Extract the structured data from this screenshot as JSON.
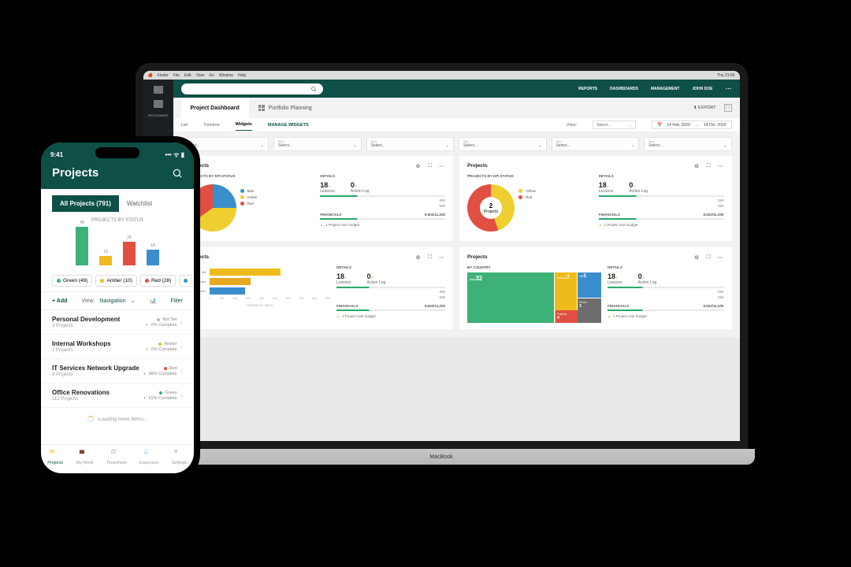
{
  "mac_menubar": {
    "items": [
      "Finder",
      "File",
      "Edit",
      "View",
      "Go",
      "Window",
      "Help"
    ],
    "time": "Thu 21:56"
  },
  "app_header": {
    "links": [
      "REPORTS",
      "DASHBOARDS",
      "MANAGEMENT",
      "JOHN DOE"
    ],
    "search_placeholder": ""
  },
  "tabs": {
    "active": "Project Dashboard",
    "second": "Portfolio Planning",
    "export": "EXPORT"
  },
  "sub_bar": {
    "items": [
      "List",
      "Timeline",
      "Widgets"
    ],
    "manage": "MANAGE WIDGETS",
    "view_label": "View:",
    "select": "Select...",
    "date_from": "14 Feb. 2020",
    "date_to": "14 Oct. 2020"
  },
  "filters": [
    {
      "label": "filter",
      "value": "Select..."
    },
    {
      "label": "filter",
      "value": "Select..."
    },
    {
      "label": "filter",
      "value": "Select..."
    },
    {
      "label": "filter",
      "value": "Select..."
    },
    {
      "label": "filter",
      "value": "Select..."
    },
    {
      "label": "filter",
      "value": "Select..."
    }
  ],
  "widgets": [
    {
      "title": "Projects",
      "chart_title": "PROJECTS BY KPI STATUS",
      "type": "pie",
      "details_title": "DETAILS",
      "m1": {
        "n": "18",
        "plus": "+",
        "label": "Lessons"
      },
      "m2": {
        "n": "0",
        "plus": "+",
        "label": "Action Log"
      },
      "m1n": "998",
      "m2n": "999",
      "fin_label": "FINANCIALS",
      "fin_val": "8,502/11,200",
      "warn": "1 Project over budget",
      "legend": [
        {
          "label": "Blue",
          "color": "#3b8ecc"
        },
        {
          "label": "Amber",
          "color": "#e7a821"
        },
        {
          "label": "Red",
          "color": "#e04f42"
        }
      ]
    },
    {
      "title": "Projects",
      "chart_title": "PROJECTS BY KPI STATUS",
      "type": "donut",
      "center_n": "2",
      "center_l": "Projects",
      "details_title": "DETAILS",
      "m1": {
        "n": "18",
        "plus": "+",
        "label": "Lessons"
      },
      "m2": {
        "n": "0",
        "plus": "+",
        "label": "Action Log"
      },
      "m1n": "998",
      "m2n": "999",
      "fin_label": "FINANCIALS",
      "fin_val": "8,502/11,200",
      "warn": "1 Project over budget",
      "legend": [
        {
          "label": "Yellow",
          "color": "#efcf2f"
        },
        {
          "label": "Red",
          "color": "#e04f42"
        }
      ]
    },
    {
      "title": "Projects",
      "chart_title": "",
      "type": "hbar",
      "x_title": "NUMBER OF USERS",
      "details_title": "DETAILS",
      "m1": {
        "n": "18",
        "plus": "+",
        "label": "Lessons"
      },
      "m2": {
        "n": "0",
        "plus": "+",
        "label": "Action Log"
      },
      "m1n": "998",
      "m2n": "999",
      "fin_label": "FINANCIALS",
      "fin_val": "8,502/11,200",
      "warn": "1 Project over budget"
    },
    {
      "title": "Projects",
      "chart_title": "BY COUNTRY",
      "type": "treemap",
      "details_title": "DETAILS",
      "m1": {
        "n": "18",
        "plus": "+",
        "label": "Lessons"
      },
      "m2": {
        "n": "0",
        "plus": "+",
        "label": "Action Log"
      },
      "m1n": "998",
      "m2n": "999",
      "fin_label": "FINANCIALS",
      "fin_val": "8,502/11,200",
      "warn": "1 Project over budget"
    }
  ],
  "chart_data": {
    "pie1": {
      "type": "pie",
      "series": [
        {
          "name": "Blue",
          "value": 25,
          "color": "#3b8ecc"
        },
        {
          "name": "Amber",
          "value": 40,
          "color": "#efcf2f"
        },
        {
          "name": "Red",
          "value": 35,
          "color": "#e04f42"
        }
      ]
    },
    "donut1": {
      "type": "pie",
      "series": [
        {
          "name": "Yellow",
          "value": 45,
          "color": "#efcf2f"
        },
        {
          "name": "Red",
          "value": 55,
          "color": "#e04f42"
        }
      ],
      "center": "2 Projects"
    },
    "hbar": {
      "type": "bar",
      "orientation": "horizontal",
      "categories": [
        "Not Set",
        "Amber",
        "Green"
      ],
      "values": [
        600,
        350,
        300
      ],
      "colors": [
        "#efbb1c",
        "#e7a821",
        "#3b8ecc"
      ],
      "xlim": [
        0,
        900
      ],
      "xticks": [
        0,
        100,
        200,
        300,
        400,
        500,
        600,
        700,
        800,
        900
      ],
      "ylabel": "",
      "xlabel": "NUMBER OF USERS"
    },
    "treemap": {
      "type": "treemap",
      "items": [
        {
          "name": "Italy",
          "value": 32,
          "color": "#3db178"
        },
        {
          "name": "Ireland",
          "value": 7,
          "color": "#efbb1c"
        },
        {
          "name": "UK",
          "value": 5,
          "color": "#3b8ecc"
        },
        {
          "name": "France",
          "value": 4,
          "color": "#e04f42"
        },
        {
          "name": "Portu",
          "value": 3,
          "color": "#6d6d6d"
        }
      ]
    },
    "phone_bars": {
      "type": "bar",
      "title": "PROJECTS BY STATUS",
      "categories": [
        "Green",
        "Amber",
        "Red",
        "Blue"
      ],
      "values": [
        49,
        10,
        28,
        18
      ],
      "colors": [
        "#3db178",
        "#efbb1c",
        "#e04f42",
        "#3b8ecc"
      ]
    }
  },
  "phone": {
    "time": "9:41",
    "title": "Projects",
    "tabs": {
      "active": "All Projects (791)",
      "other": "Watchlist"
    },
    "chart_title": "PROJECTS BY STATUS",
    "legend": [
      {
        "label": "Green (49)",
        "color": "#3db178"
      },
      {
        "label": "Amber (10)",
        "color": "#efbb1c"
      },
      {
        "label": "Red (28)",
        "color": "#e04f42"
      },
      {
        "label": "",
        "color": "#3b8ecc"
      }
    ],
    "add": "Add",
    "view_label": "View:",
    "view_value": "Navigation",
    "filter": "Filter",
    "items": [
      {
        "title": "Personal Development",
        "sub": "3 Projects",
        "status": "Not Set",
        "status_color": "#bbb",
        "pct": "0% Complete"
      },
      {
        "title": "Internal Workshops",
        "sub": "2 Projects",
        "status": "Amber",
        "status_color": "#efbb1c",
        "pct": "6% Complete"
      },
      {
        "title": "IT Services Network Upgrade",
        "sub": "9 Projects",
        "status": "Red",
        "status_color": "#e04f42",
        "pct": "38% Complete"
      },
      {
        "title": "Office Renovations",
        "sub": "112 Projects",
        "status": "Green",
        "status_color": "#3db178",
        "pct": "62% Complete"
      }
    ],
    "loading": "Loading more items...",
    "nav": [
      {
        "label": "Projects",
        "active": true
      },
      {
        "label": "My Work"
      },
      {
        "label": "Timesheet"
      },
      {
        "label": "Expenses"
      },
      {
        "label": "Settings"
      }
    ]
  },
  "laptop_brand": "MacBook"
}
